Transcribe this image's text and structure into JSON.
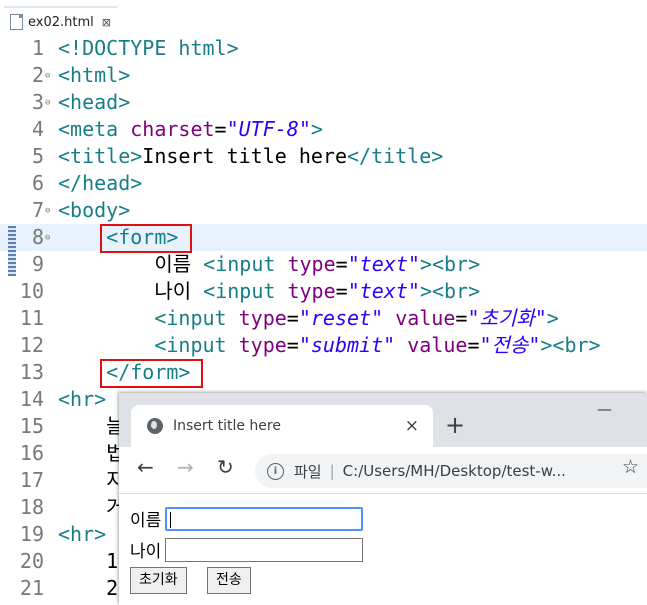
{
  "editor_tab": {
    "title": "ex02.html",
    "close": "⊠"
  },
  "lines": [
    {
      "n": "1",
      "fold": "",
      "parts": [
        [
          "t",
          "<!DOCTYPE html>"
        ]
      ]
    },
    {
      "n": "2",
      "fold": "⊖",
      "parts": [
        [
          "t",
          "<html>"
        ]
      ]
    },
    {
      "n": "3",
      "fold": "⊖",
      "parts": [
        [
          "t",
          "<head>"
        ]
      ]
    },
    {
      "n": "4",
      "fold": "",
      "parts": [
        [
          "t",
          "<meta "
        ],
        [
          "a",
          "charset"
        ],
        [
          "txt",
          "="
        ],
        [
          "v",
          "\"UTF-8\""
        ],
        [
          "t",
          ">"
        ]
      ]
    },
    {
      "n": "5",
      "fold": "",
      "parts": [
        [
          "t",
          "<title>"
        ],
        [
          "txt",
          "Insert title here"
        ],
        [
          "t",
          "</title>"
        ]
      ]
    },
    {
      "n": "6",
      "fold": "",
      "parts": [
        [
          "t",
          "</head>"
        ]
      ]
    },
    {
      "n": "7",
      "fold": "⊖",
      "parts": [
        [
          "t",
          "<body>"
        ]
      ]
    },
    {
      "n": "8",
      "fold": "⊖",
      "parts": [
        [
          "txt",
          "    "
        ],
        [
          "t",
          "<form>"
        ]
      ]
    },
    {
      "n": "9",
      "fold": "",
      "parts": [
        [
          "txt",
          "        이름 "
        ],
        [
          "t",
          "<input "
        ],
        [
          "a",
          "type"
        ],
        [
          "txt",
          "="
        ],
        [
          "v",
          "\"text\""
        ],
        [
          "t",
          "><br>"
        ]
      ]
    },
    {
      "n": "10",
      "fold": "",
      "parts": [
        [
          "txt",
          "        나이 "
        ],
        [
          "t",
          "<input "
        ],
        [
          "a",
          "type"
        ],
        [
          "txt",
          "="
        ],
        [
          "v",
          "\"text\""
        ],
        [
          "t",
          "><br>"
        ]
      ]
    },
    {
      "n": "11",
      "fold": "",
      "parts": [
        [
          "txt",
          "        "
        ],
        [
          "t",
          "<input "
        ],
        [
          "a",
          "type"
        ],
        [
          "txt",
          "="
        ],
        [
          "v",
          "\"reset\""
        ],
        [
          "txt",
          " "
        ],
        [
          "a",
          "value"
        ],
        [
          "txt",
          "="
        ],
        [
          "v",
          "\"초기화\""
        ],
        [
          "t",
          ">"
        ]
      ]
    },
    {
      "n": "12",
      "fold": "",
      "parts": [
        [
          "txt",
          "        "
        ],
        [
          "t",
          "<input "
        ],
        [
          "a",
          "type"
        ],
        [
          "txt",
          "="
        ],
        [
          "v",
          "\"submit\""
        ],
        [
          "txt",
          " "
        ],
        [
          "a",
          "value"
        ],
        [
          "txt",
          "="
        ],
        [
          "v",
          "\"전송\""
        ],
        [
          "t",
          "><br>"
        ]
      ]
    },
    {
      "n": "13",
      "fold": "",
      "parts": [
        [
          "txt",
          "    "
        ],
        [
          "t",
          "</form>"
        ]
      ]
    },
    {
      "n": "14",
      "fold": "",
      "parts": [
        [
          "t",
          "<hr>"
        ]
      ]
    },
    {
      "n": "15",
      "fold": "",
      "parts": [
        [
          "txt",
          "    늘"
        ]
      ]
    },
    {
      "n": "16",
      "fold": "",
      "parts": [
        [
          "txt",
          "    법"
        ]
      ]
    },
    {
      "n": "17",
      "fold": "",
      "parts": [
        [
          "txt",
          "    지"
        ]
      ]
    },
    {
      "n": "18",
      "fold": "",
      "parts": [
        [
          "txt",
          "    거"
        ]
      ]
    },
    {
      "n": "19",
      "fold": "",
      "parts": [
        [
          "t",
          "<hr>"
        ]
      ]
    },
    {
      "n": "20",
      "fold": "",
      "parts": [
        [
          "txt",
          "    1"
        ]
      ]
    },
    {
      "n": "21",
      "fold": "",
      "parts": [
        [
          "txt",
          "    2"
        ]
      ]
    }
  ],
  "browser": {
    "tab_title": "Insert title here",
    "tab_close": "×",
    "new_tab": "+",
    "minimize": "—",
    "back": "←",
    "forward": "→",
    "reload": "↻",
    "info": "i",
    "scheme_label": "파일",
    "separator": "|",
    "url": "C:/Users/MH/Desktop/test-w...",
    "star": "☆",
    "form": {
      "name_label": "이름",
      "age_label": "나이",
      "reset_label": "초기화",
      "submit_label": "전송"
    }
  }
}
